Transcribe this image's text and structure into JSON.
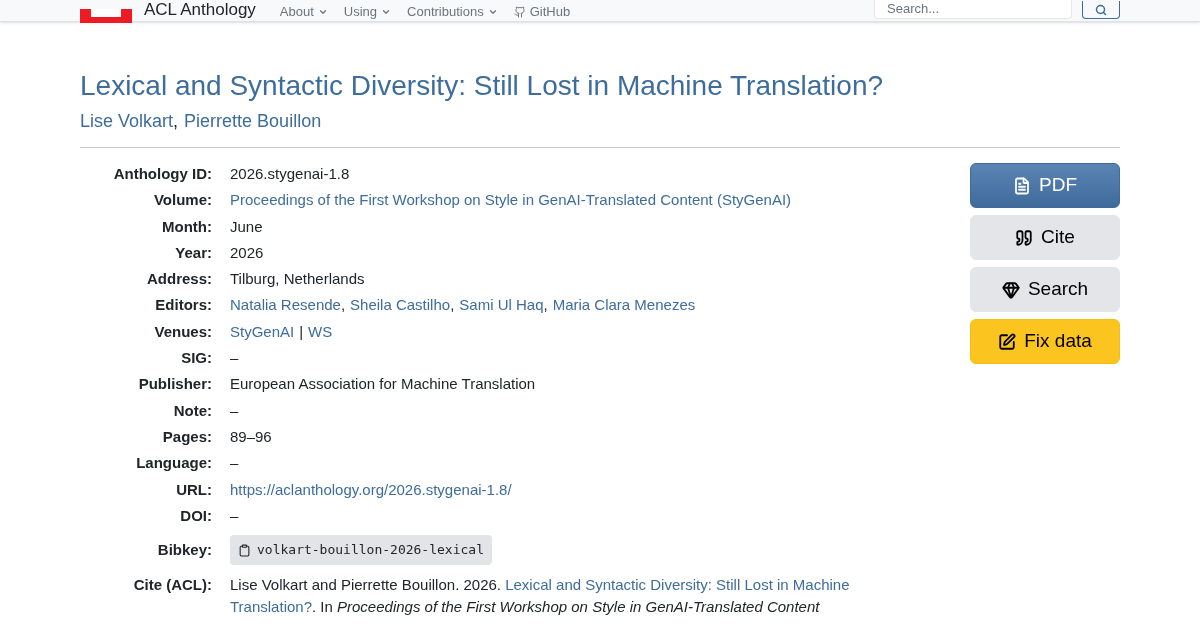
{
  "navbar": {
    "brand": "ACL Anthology",
    "menus": [
      {
        "label": "About",
        "kind": "dropdown"
      },
      {
        "label": "Using",
        "kind": "dropdown"
      },
      {
        "label": "Contributions",
        "kind": "dropdown"
      },
      {
        "label": "GitHub",
        "kind": "github"
      }
    ],
    "search": {
      "placeholder": "Search..."
    }
  },
  "title": "Lexical and Syntactic Diversity: Still Lost in Machine Translation?",
  "authors": [
    "Lise Volkart",
    "Pierrette Bouillon"
  ],
  "author_separator": ",",
  "details": [
    {
      "label": "Anthology ID:",
      "kind": "text",
      "parts": [
        {
          "text": "2026.stygenai-1.8",
          "link": false
        }
      ]
    },
    {
      "label": "Volume:",
      "kind": "text",
      "parts": [
        {
          "text": "Proceedings of the First Workshop on Style in GenAI-Translated Content (StyGenAI)",
          "link": true
        }
      ]
    },
    {
      "label": "Month:",
      "kind": "text",
      "parts": [
        {
          "text": "June",
          "link": false
        }
      ]
    },
    {
      "label": "Year:",
      "kind": "text",
      "parts": [
        {
          "text": "2026",
          "link": false
        }
      ]
    },
    {
      "label": "Address:",
      "kind": "text",
      "parts": [
        {
          "text": "Tilburg, Netherlands",
          "link": false
        }
      ]
    },
    {
      "label": "Editors:",
      "kind": "text",
      "parts": [
        {
          "text": "Natalia Resende",
          "link": true
        },
        {
          "text": ",",
          "link": false
        },
        {
          "text": "Sheila Castilho",
          "link": true
        },
        {
          "text": ",",
          "link": false
        },
        {
          "text": "Sami Ul Haq",
          "link": true
        },
        {
          "text": ",",
          "link": false
        },
        {
          "text": "Maria Clara Menezes",
          "link": true
        }
      ]
    },
    {
      "label": "Venues:",
      "kind": "text",
      "parts": [
        {
          "text": "StyGenAI",
          "link": true
        },
        {
          "text": "|",
          "link": false
        },
        {
          "text": "WS",
          "link": true
        }
      ]
    },
    {
      "label": "SIG:",
      "kind": "text",
      "parts": [
        {
          "text": "–",
          "link": false
        }
      ]
    },
    {
      "label": "Publisher:",
      "kind": "text",
      "parts": [
        {
          "text": "European Association for Machine Translation",
          "link": false
        }
      ]
    },
    {
      "label": "Note:",
      "kind": "text",
      "parts": [
        {
          "text": "–",
          "link": false
        }
      ]
    },
    {
      "label": "Pages:",
      "kind": "text",
      "parts": [
        {
          "text": "89–96",
          "link": false
        }
      ]
    },
    {
      "label": "Language:",
      "kind": "text",
      "parts": [
        {
          "text": "–",
          "link": false
        }
      ]
    },
    {
      "label": "URL:",
      "kind": "text",
      "parts": [
        {
          "text": "https://aclanthology.org/2026.stygenai-1.8/",
          "link": true
        }
      ]
    },
    {
      "label": "DOI:",
      "kind": "text",
      "parts": [
        {
          "text": "–",
          "link": false
        }
      ]
    },
    {
      "label": "Bibkey:",
      "kind": "code",
      "value": "volkart-bouillon-2026-lexical"
    },
    {
      "label": "Cite (ACL):",
      "kind": "cite",
      "parts": [
        {
          "text": "Lise Volkart and Pierrette Bouillon. 2026.",
          "link": false
        },
        {
          "text": "Lexical and Syntactic Diversity: Still Lost in Machine",
          "link": true
        },
        {
          "text": "Translation?",
          "link": true
        },
        {
          "text": ". In *Proceedings of the First Workshop on Style in GenAI-Translated Content*",
          "link": false
        }
      ]
    }
  ],
  "actions": [
    {
      "label": "PDF",
      "kind": "pdf"
    },
    {
      "label": "Cite",
      "kind": "cite"
    },
    {
      "label": "Search",
      "kind": "search"
    },
    {
      "label": "Fix data",
      "kind": "fix"
    }
  ]
}
